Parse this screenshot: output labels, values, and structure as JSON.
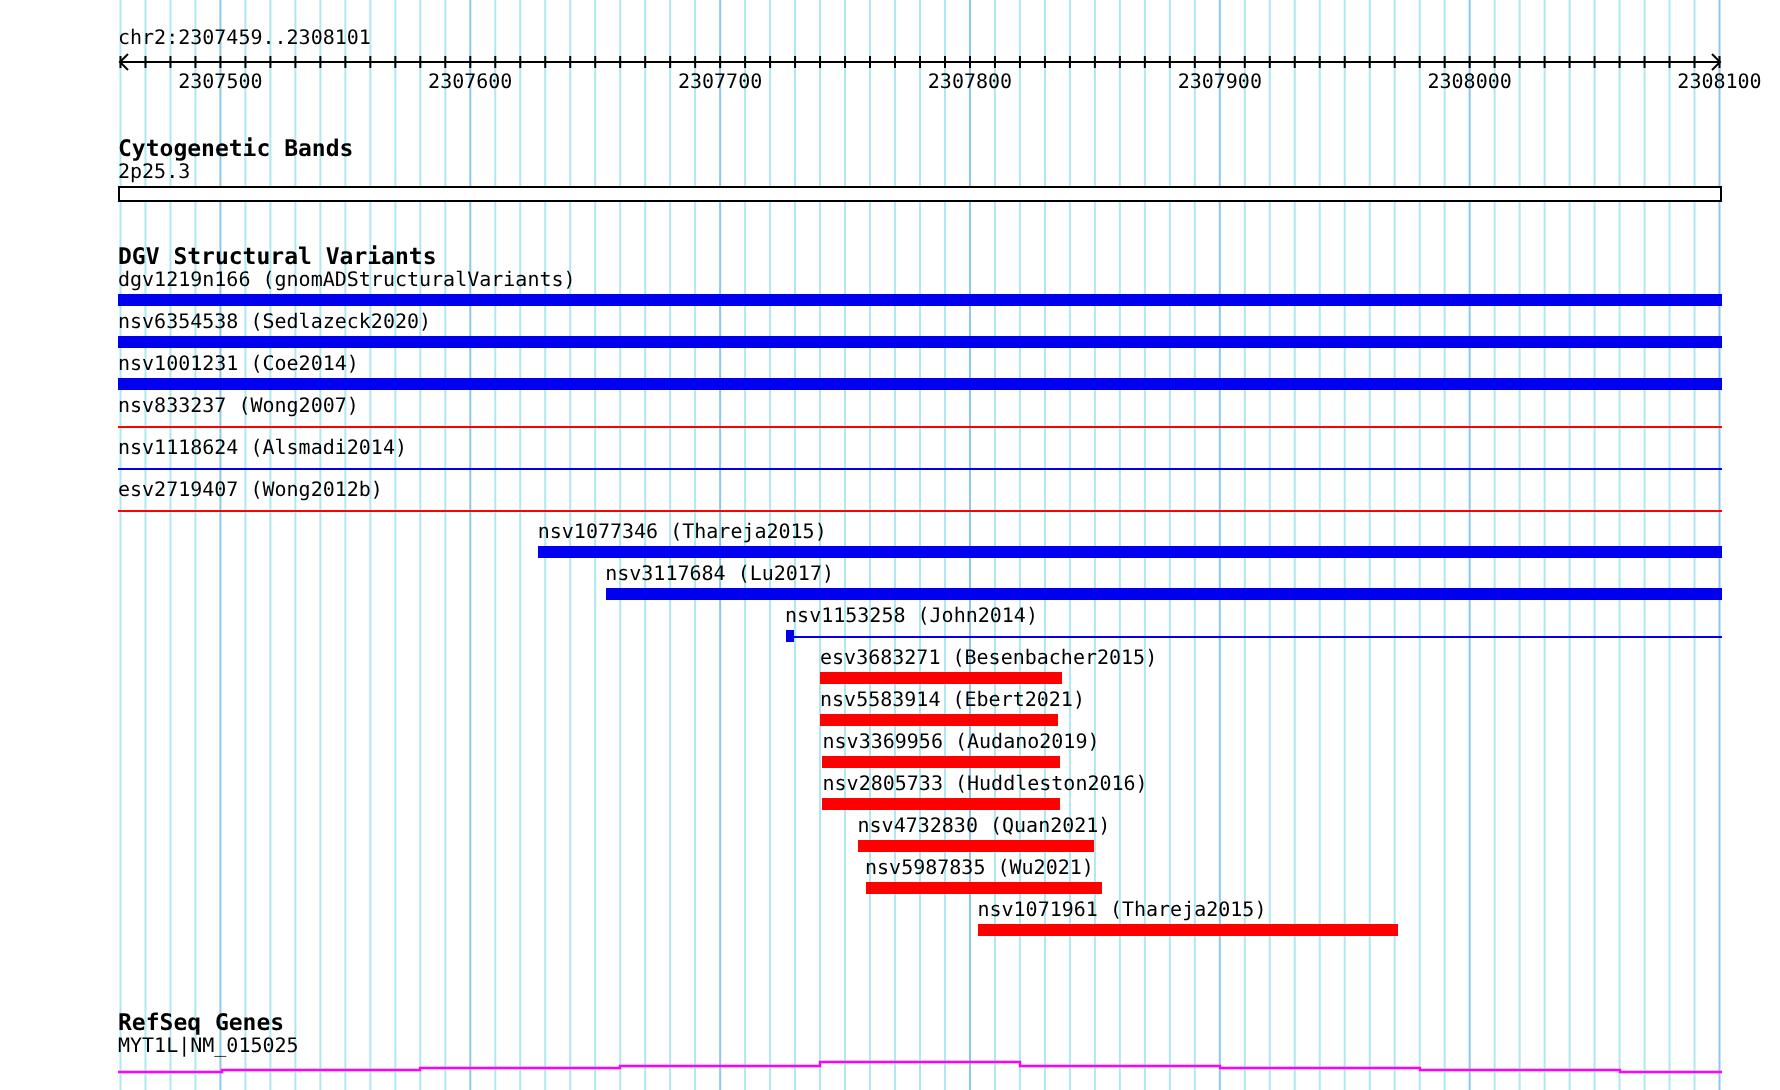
{
  "ruler": {
    "location": "chr2:2307459..2308101",
    "labels": [
      "2307500",
      "2307600",
      "2307700",
      "2307800",
      "2307900",
      "2308000",
      "2308100"
    ]
  },
  "cytogenetic_bands": {
    "title": "Cytogenetic Bands",
    "bands": [
      {
        "label": "2p25.3"
      }
    ]
  },
  "dgv_structural_variants": {
    "title": "DGV Structural Variants",
    "features": [
      {
        "label": "dgv1219n166 (gnomADStructuralVariants)",
        "color": "#0000ee",
        "kind": "bar"
      },
      {
        "label": "nsv6354538 (Sedlazeck2020)",
        "color": "#0000ee",
        "kind": "bar"
      },
      {
        "label": "nsv1001231 (Coe2014)",
        "color": "#0000ee",
        "kind": "bar"
      },
      {
        "label": "nsv833237 (Wong2007)",
        "color": "#ff0000",
        "kind": "line"
      },
      {
        "label": "nsv1118624 (Alsmadi2014)",
        "color": "#0000ee",
        "kind": "line"
      },
      {
        "label": "esv2719407 (Wong2012b)",
        "color": "#ff0000",
        "kind": "line"
      },
      {
        "label": "nsv1077346 (Thareja2015)",
        "color": "#0000ee",
        "kind": "bar"
      },
      {
        "label": "nsv3117684 (Lu2017)",
        "color": "#0000ee",
        "kind": "bar"
      },
      {
        "label": "nsv1153258 (John2014)",
        "color": "#0000ee",
        "kind": "line-with-block"
      },
      {
        "label": "esv3683271 (Besenbacher2015)",
        "color": "#ff0000",
        "kind": "bar"
      },
      {
        "label": "nsv5583914 (Ebert2021)",
        "color": "#ff0000",
        "kind": "bar"
      },
      {
        "label": "nsv3369956 (Audano2019)",
        "color": "#ff0000",
        "kind": "bar"
      },
      {
        "label": "nsv2805733 (Huddleston2016)",
        "color": "#ff0000",
        "kind": "bar"
      },
      {
        "label": "nsv4732830 (Quan2021)",
        "color": "#ff0000",
        "kind": "bar"
      },
      {
        "label": "nsv5987835 (Wu2021)",
        "color": "#ff0000",
        "kind": "bar"
      },
      {
        "label": "nsv1071961 (Thareja2015)",
        "color": "#ff0000",
        "kind": "bar"
      }
    ]
  },
  "refseq_genes": {
    "title": "RefSeq Genes",
    "genes": [
      {
        "label": "MYT1L|NM_015025"
      }
    ]
  }
}
